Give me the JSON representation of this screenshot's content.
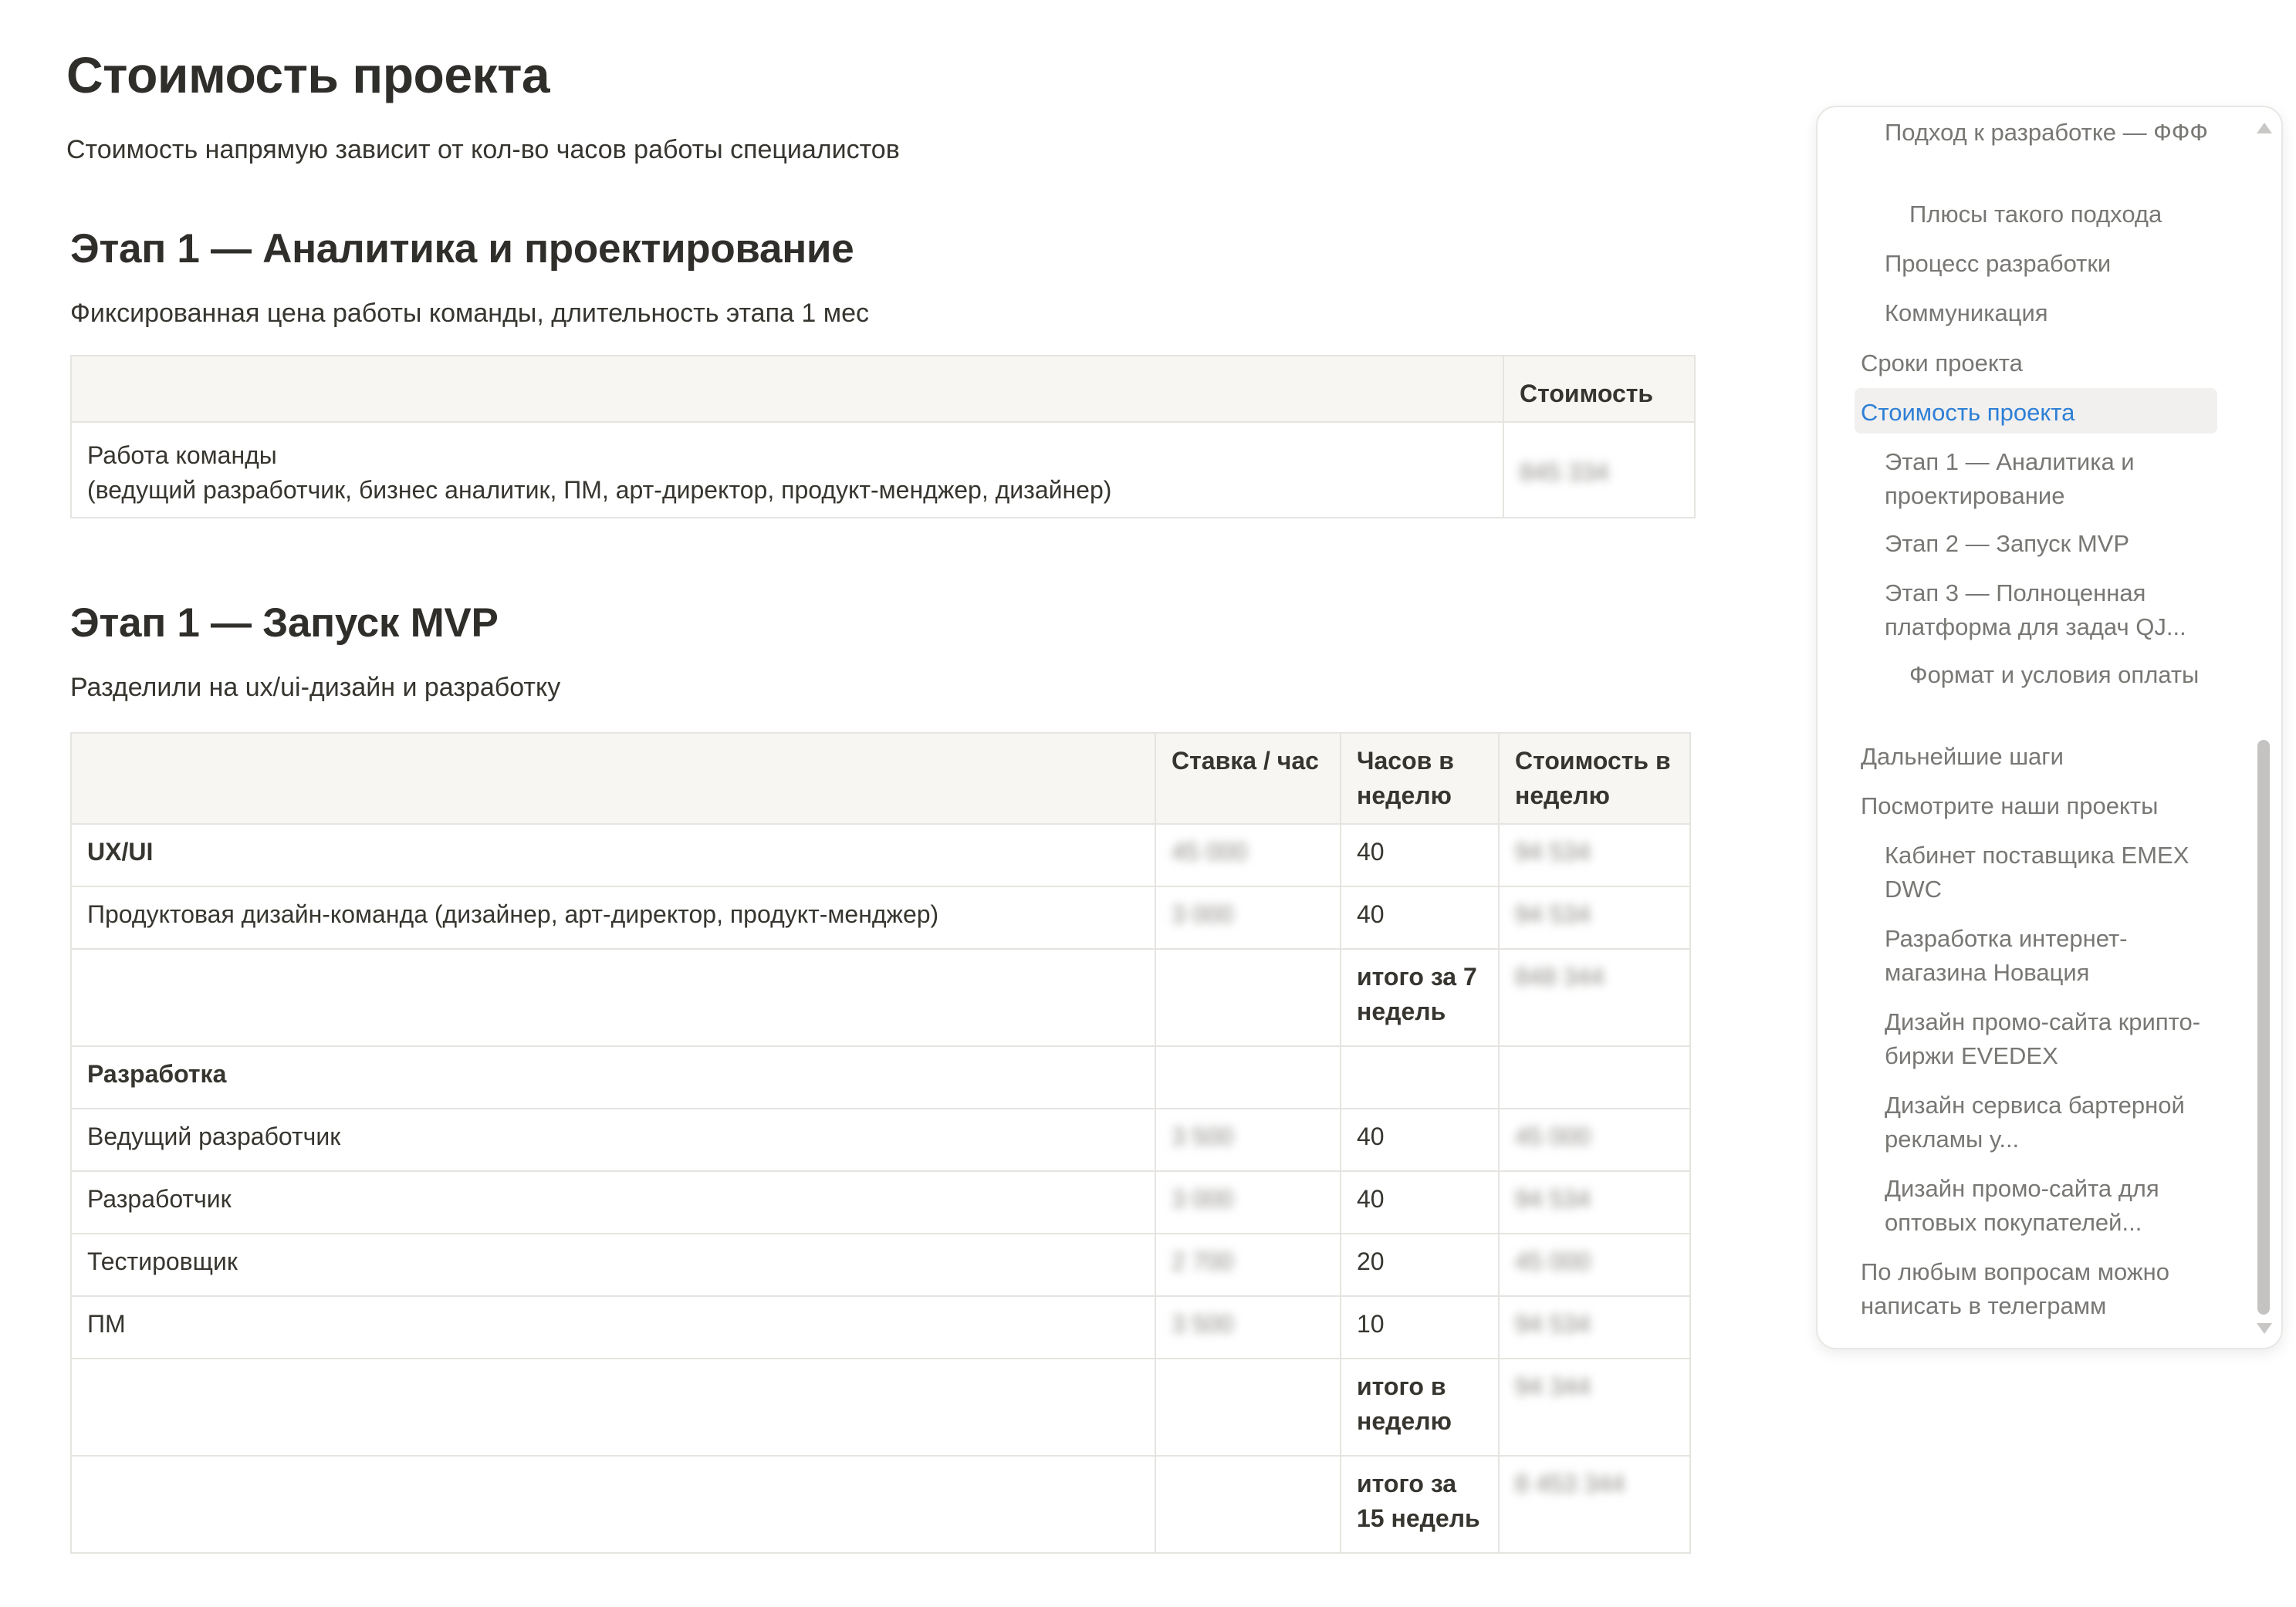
{
  "page": {
    "title": "Стоимость проекта",
    "lead": "Стоимость напрямую зависит от кол-во часов работы специалистов"
  },
  "stage1": {
    "title": "Этап 1 — Аналитика и проектирование",
    "description": "Фиксированная цена работы команды, длительность этапа 1 мес",
    "headers": [
      "",
      "Стоимость"
    ],
    "row": {
      "line1": "Работа команды",
      "line2": "(ведущий разработчик, бизнес аналитик, ПМ, арт-директор, продукт-менджер, дизайнер)",
      "cost": "845 334"
    }
  },
  "stage2": {
    "title": "Этап 1 — Запуск MVP",
    "description": "Разделили на ux/ui-дизайн и разработку",
    "headers": [
      "",
      "Ставка / час",
      "Часов в неделю",
      "Стоимость в неделю"
    ],
    "rows": [
      {
        "name": "UX/UI",
        "rate": "45 000",
        "hours": "40",
        "cost": "94 534",
        "bold": true
      },
      {
        "name": "Продуктовая дизайн-команда (дизайнер, арт-директор, продукт-менджер)",
        "rate": "3 000",
        "hours": "40",
        "cost": "94 534"
      },
      {
        "name": "",
        "rate": "",
        "hours": "итого за 7 недель",
        "cost": "848 344",
        "total": true
      },
      {
        "name": "Разработка",
        "rate": "",
        "hours": "",
        "cost": "",
        "bold": true
      },
      {
        "name": "Ведущий разработчик",
        "rate": "3 500",
        "hours": "40",
        "cost": "45 000"
      },
      {
        "name": "Разработчик",
        "rate": "3 000",
        "hours": "40",
        "cost": "94 534"
      },
      {
        "name": "Тестировщик",
        "rate": "2 700",
        "hours": "20",
        "cost": "45 000"
      },
      {
        "name": "ПМ",
        "rate": "3 500",
        "hours": "10",
        "cost": "94 534"
      },
      {
        "name": "",
        "rate": "",
        "hours": "итого в неделю",
        "cost": "94 344",
        "total": true
      },
      {
        "name": "",
        "rate": "",
        "hours": "итого за 15 недель",
        "cost": "8 453 344",
        "total": true
      }
    ]
  },
  "toc": {
    "items": [
      {
        "label": "Подход к разработке — ФФФ",
        "level": 2
      },
      {
        "label": "Плюсы такого подхода",
        "level": 3
      },
      {
        "label": "Процесс разработки",
        "level": 2
      },
      {
        "label": "Коммуникация",
        "level": 2
      },
      {
        "label": "Сроки проекта",
        "level": 1
      },
      {
        "label": "Стоимость проекта",
        "level": 1,
        "active": true
      },
      {
        "label": "Этап 1 — Аналитика и проектирование",
        "level": 2
      },
      {
        "label": "Этап 2 — Запуск MVP",
        "level": 2
      },
      {
        "label": "Этап 3 — Полноценная платформа для задач QJ...",
        "level": 2
      },
      {
        "label": "Формат и условия оплаты",
        "level": 3
      },
      {
        "label": "Дальнейшие шаги",
        "level": 1
      },
      {
        "label": "Посмотрите наши проекты",
        "level": 1
      },
      {
        "label": "Кабинет поставщика EMEX DWC",
        "level": 2
      },
      {
        "label": "Разработка интернет-магазина Новация",
        "level": 2
      },
      {
        "label": "Дизайн промо-сайта крипто-биржи EVEDEX",
        "level": 2
      },
      {
        "label": "Дизайн сервиса бартерной рекламы у...",
        "level": 2
      },
      {
        "label": "Дизайн промо-сайта для оптовых покупателей...",
        "level": 2
      },
      {
        "label": "По любым вопросам можно написать в телеграмм",
        "level": 1
      }
    ],
    "active_color": "#2e7fd6"
  }
}
